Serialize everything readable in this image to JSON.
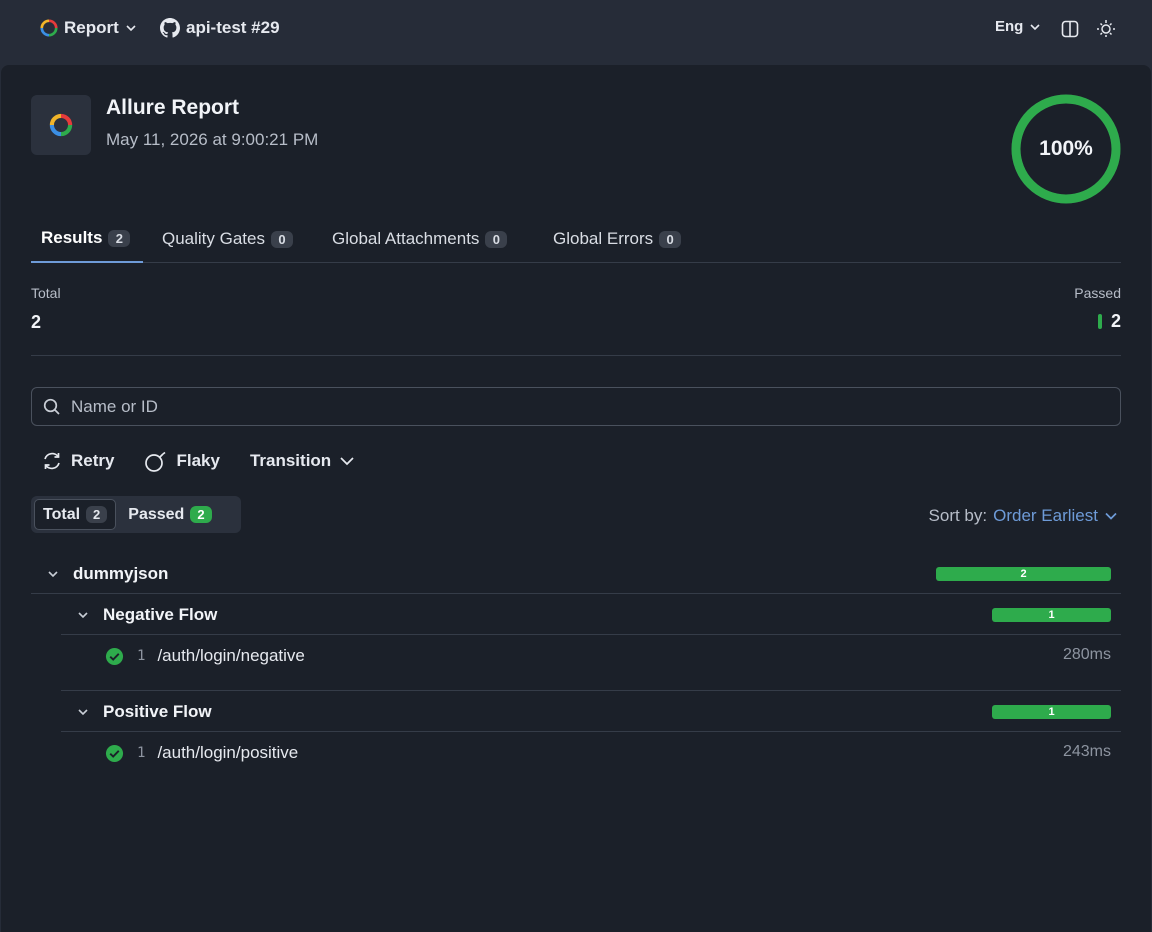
{
  "topbar": {
    "report_label": "Report",
    "repo_label": "api-test #29",
    "language": "Eng"
  },
  "header": {
    "title": "Allure Report",
    "date": "May 11, 2026 at 9:00:21 PM",
    "success_rate": "100%",
    "success_fraction": 1.0
  },
  "tabs": [
    {
      "label": "Results",
      "count": "2",
      "active": true
    },
    {
      "label": "Quality Gates",
      "count": "0"
    },
    {
      "label": "Global Attachments",
      "count": "0"
    },
    {
      "label": "Global Errors",
      "count": "0"
    }
  ],
  "stats": {
    "total_label": "Total",
    "total_value": "2",
    "passed_label": "Passed",
    "passed_value": "2"
  },
  "search": {
    "placeholder": "Name or ID"
  },
  "filters": {
    "retry": "Retry",
    "flaky": "Flaky",
    "transition": "Transition"
  },
  "status_tabs": [
    {
      "label": "Total",
      "count": "2",
      "active": true
    },
    {
      "label": "Passed",
      "count": "2"
    }
  ],
  "sort": {
    "label": "Sort by:",
    "value": "Order Earliest"
  },
  "tree": {
    "root": {
      "name": "dummyjson",
      "count": "2"
    },
    "groups": [
      {
        "name": "Negative Flow",
        "count": "1",
        "test": {
          "num": "1",
          "name": "/auth/login/negative",
          "duration": "280ms"
        }
      },
      {
        "name": "Positive Flow",
        "count": "1",
        "test": {
          "num": "1",
          "name": "/auth/login/positive",
          "duration": "243ms"
        }
      }
    ]
  },
  "colors": {
    "passed": "#2eab4c",
    "accent": "#6e9bd8",
    "background": "#1b2029"
  }
}
